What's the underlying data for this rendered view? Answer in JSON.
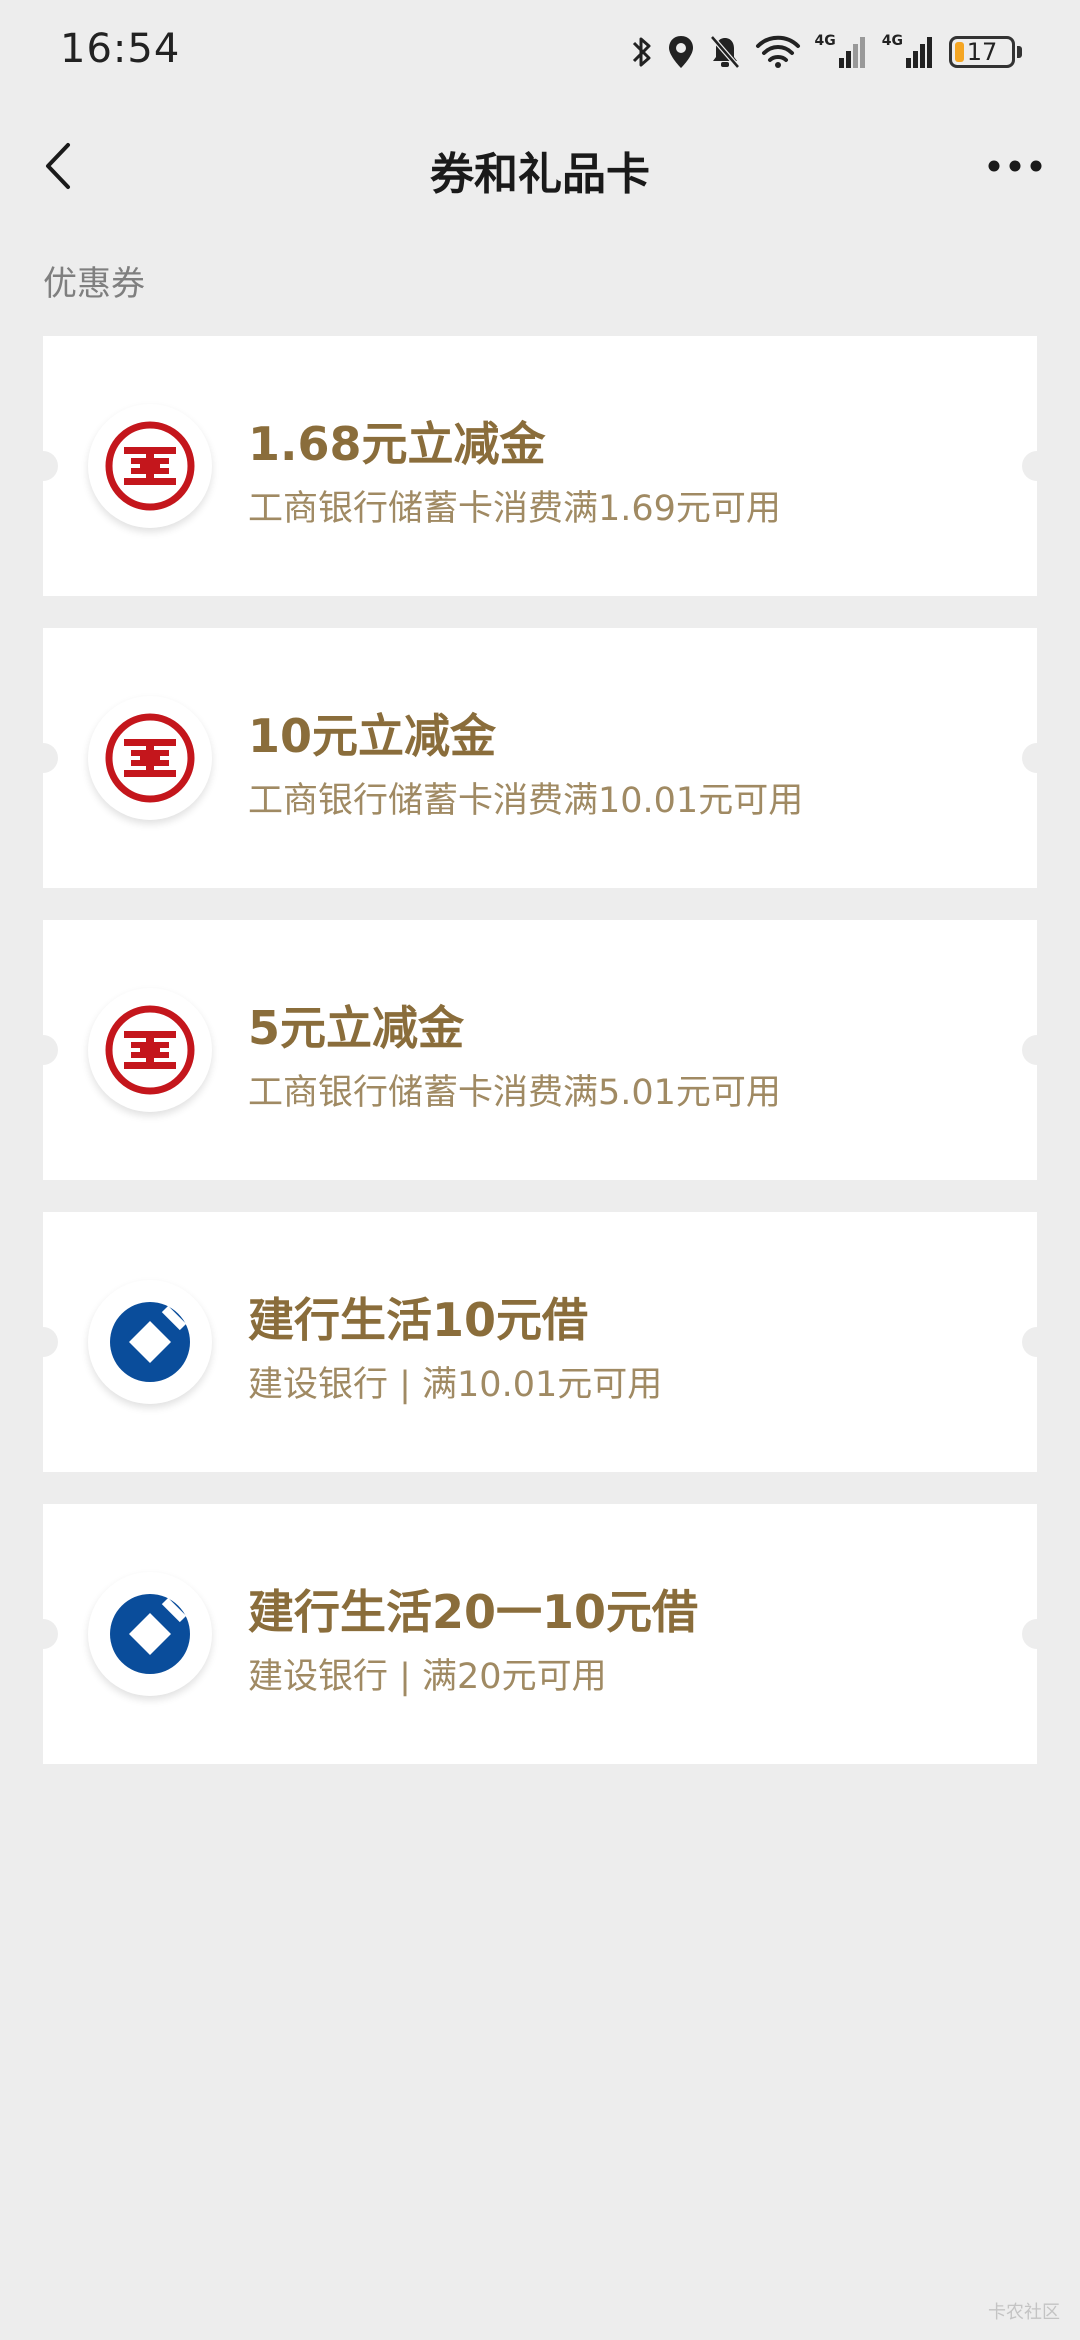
{
  "status_bar": {
    "time": "16:54",
    "network1_label": "4G",
    "network2_label": "4G",
    "battery_level": "17",
    "battery_fraction": 0.17,
    "battery_color": "#f5a623"
  },
  "nav": {
    "title": "券和礼品卡",
    "back_icon": "chevron-left-icon",
    "more_icon": "more-icon"
  },
  "section": {
    "title": "优惠券"
  },
  "coupons": [
    {
      "title": "1.68元立减金",
      "desc": "工商银行储蓄卡消费满1.69元可用",
      "bank": "icbc"
    },
    {
      "title": "10元立减金",
      "desc": "工商银行储蓄卡消费满10.01元可用",
      "bank": "icbc"
    },
    {
      "title": "5元立减金",
      "desc": "工商银行储蓄卡消费满5.01元可用",
      "bank": "icbc"
    },
    {
      "title": "建行生活10元借",
      "desc": "建设银行 | 满10.01元可用",
      "bank": "ccb"
    },
    {
      "title": "建行生活20一10元借",
      "desc": "建设银行 | 满20元可用",
      "bank": "ccb"
    }
  ],
  "colors": {
    "background": "#ededed",
    "title_gold": "#8a6d3b",
    "desc_gold": "#a08a63",
    "icbc_red": "#c4161c",
    "ccb_blue": "#0a4d9b"
  },
  "watermark": "卡农社区"
}
